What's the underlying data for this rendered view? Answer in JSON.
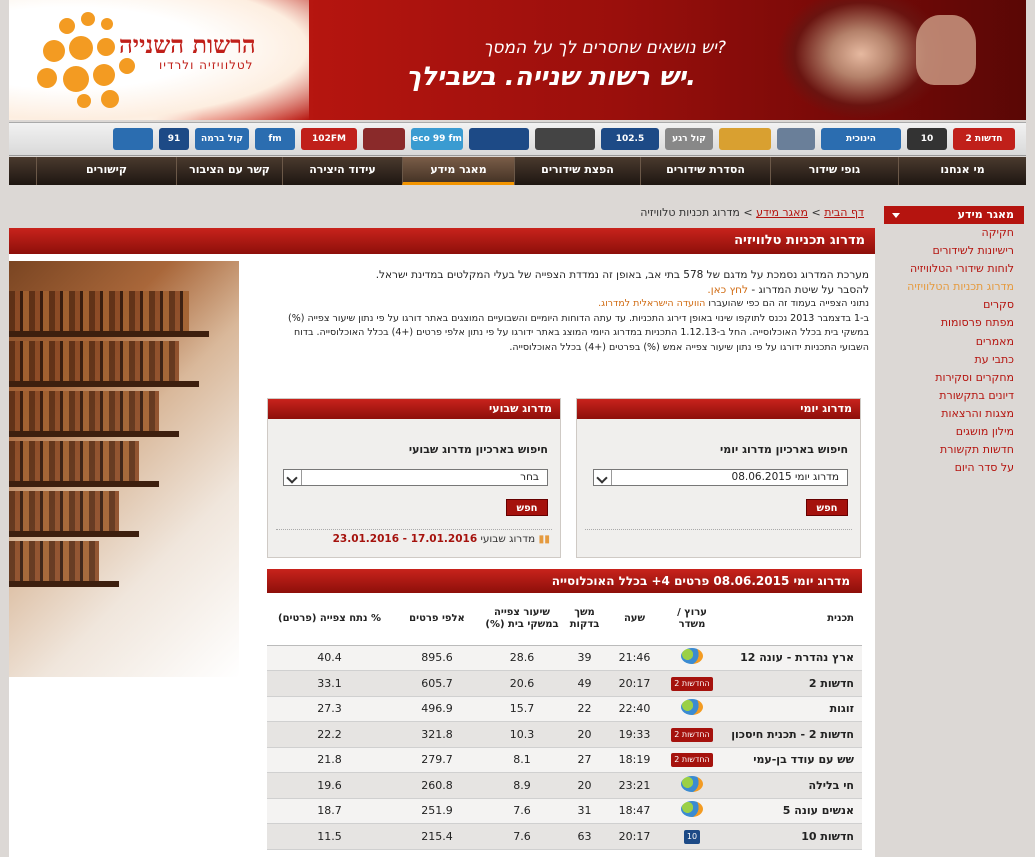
{
  "header": {
    "logo_title": "הרשות השנייה",
    "logo_subtitle": "לטלוויזיה ולרדיו",
    "slogan_line1": "יש נושאים שחסרים לך על המסך?",
    "slogan_line2": "יש רשות שנייה. בשבילך."
  },
  "channel_logos": [
    {
      "label": "חדשות 2",
      "color": "#c0201a"
    },
    {
      "label": "10",
      "color": "#333333"
    },
    {
      "label": "הינוכית",
      "color": "#2b6db0"
    },
    {
      "label": "",
      "color": "#6a7f99"
    },
    {
      "label": "",
      "color": "#d9a030"
    },
    {
      "label": "קול רגע",
      "color": "#888888"
    },
    {
      "label": "102.5",
      "color": "#1d4a86"
    },
    {
      "label": "",
      "color": "#444444"
    },
    {
      "label": "",
      "color": "#1d4a86"
    },
    {
      "label": "eco 99 fm",
      "color": "#3a9bd1"
    },
    {
      "label": "",
      "color": "#8a2a2a"
    },
    {
      "label": "102FM",
      "color": "#c0201a"
    },
    {
      "label": "fm",
      "color": "#2b6db0"
    },
    {
      "label": "קול ברמה",
      "color": "#2b6db0"
    },
    {
      "label": "91",
      "color": "#1d4a86"
    },
    {
      "label": "",
      "color": "#2b6db0"
    }
  ],
  "nav": [
    "מי אנחנו",
    "גופי שידור",
    "הסדרת שידורים",
    "הפצת שידורים",
    "מאגר מידע",
    "עידוד היצירה",
    "קשר עם הציבור",
    "קישורים"
  ],
  "nav_active_index": 4,
  "breadcrumb": {
    "home": "דף הבית",
    "section": "מאגר מידע",
    "current": "מדרוג תכניות טלוויזיה",
    "sep": " > "
  },
  "sidebar": {
    "title": "מאגר מידע",
    "items": [
      "חקיקה",
      "רישיונות לשידורים",
      "לוחות שידורי הטלוויזיה",
      "מדרוג תכניות הטלוויזיה",
      "סקרים",
      "מפתח פרסומות",
      "מאמרים",
      "כתבי עת",
      "מחקרים וסקירות",
      "דיונים בתקשורת",
      "מצגות והרצאות",
      "מילון מושגים",
      "חדשות תקשורת",
      "על סדר היום"
    ],
    "active_index": 3
  },
  "page_title": "מדרוג תכניות טלוויזיה",
  "intro": {
    "p1": "מערכת המדרוג נסמכת על מדגם של 578 בתי אב, באופן זה נמדדת הצפייה של בעלי המקלטים במדינת ישראל.",
    "p2_text": "להסבר על שיטת המדרוג - ",
    "p2_link": "לחץ כאן.",
    "p3_text": "נתוני הצפייה בעמוד זה הם כפי שהועברו ",
    "p3_link": "הוועדה הישראלית למדרוג.",
    "p4": "ב-1 בדצמבר 2013 נכנס לתוקפו שינוי באופן דירוג התכניות. עד עתה הדוחות היומיים והשבועיים המוצגים באתר דורגו על פי נתון שיעור צפייה (%) במשקי בית בכלל האוכלוסייה. החל ב-1.12.13 התכניות במדרוג היומי המוצג באתר ידורגו על פי נתון אלפי פרטים (+4) בכלל האוכלוסייה. בדוח השבועי התכניות ידורגו על פי נתון שיעור צפייה אמש (%) בפרטים (+4) בכלל האוכלוסייה."
  },
  "daily_box": {
    "title": "מדרוג יומי",
    "label": "חיפוש בארכיון מדרוג יומי",
    "select_value": "מדרוג יומי 08.06.2015",
    "button": "חפש"
  },
  "weekly_box": {
    "title": "מדרוג שבועי",
    "label": "חיפוש בארכיון מדרוג שבועי",
    "select_value": "בחר",
    "button": "חפש",
    "footer_label": "מדרוג שבועי",
    "footer_dates": "17.01.2016 - 23.01.2016"
  },
  "table": {
    "title": "מדרוג יומי 08.06.2015 פרטים 4+ בכלל האוכלוסייה",
    "headers": [
      "תכנית",
      "ערוץ / משדר",
      "שעה",
      "משך בדקות",
      "שיעור צפייה במשקי בית (%)",
      "אלפי פרטים",
      "% נתח צפייה (פרטים)"
    ],
    "rows": [
      {
        "program": "ארץ נהדרת - עונה 12",
        "channel": "רשת",
        "time": "21:46",
        "duration": "39",
        "rating": "28.6",
        "thousands": "895.6",
        "share": "40.4"
      },
      {
        "program": "חדשות 2",
        "channel": "החדשות 2",
        "time": "20:17",
        "duration": "49",
        "rating": "20.6",
        "thousands": "605.7",
        "share": "33.1"
      },
      {
        "program": "זוגות",
        "channel": "רשת",
        "time": "22:40",
        "duration": "22",
        "rating": "15.7",
        "thousands": "496.9",
        "share": "27.3"
      },
      {
        "program": "חדשות 2 - תכנית חיסכון",
        "channel": "החדשות 2",
        "time": "19:33",
        "duration": "20",
        "rating": "10.3",
        "thousands": "321.8",
        "share": "22.2"
      },
      {
        "program": "שש עם עודד בן-עמי",
        "channel": "החדשות 2",
        "time": "18:19",
        "duration": "27",
        "rating": "8.1",
        "thousands": "279.7",
        "share": "21.8"
      },
      {
        "program": "חי בלילה",
        "channel": "רשת",
        "time": "23:21",
        "duration": "20",
        "rating": "8.9",
        "thousands": "260.8",
        "share": "19.6"
      },
      {
        "program": "אנשים עונה 5",
        "channel": "רשת",
        "time": "18:47",
        "duration": "31",
        "rating": "7.6",
        "thousands": "251.9",
        "share": "18.7"
      },
      {
        "program": "חדשות 10",
        "channel": "10",
        "time": "20:17",
        "duration": "63",
        "rating": "7.6",
        "thousands": "215.4",
        "share": "11.5"
      }
    ]
  }
}
